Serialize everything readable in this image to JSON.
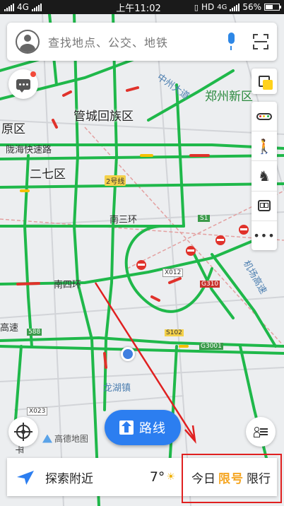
{
  "status_bar": {
    "network": "4G",
    "time": "上午11:02",
    "hd": "HD",
    "network_right": "4G",
    "battery": "56%",
    "battery_level": 0.56
  },
  "search": {
    "placeholder": "查找地点、公交、地铁"
  },
  "map": {
    "labels": {
      "zhongzhou_ave": "中州大道",
      "zhengzhou_new_district": "郑州新区",
      "guancheng": "管城回族区",
      "yuanqu": "原区",
      "longhai_expressway": "陇海快速路",
      "erqi": "二七区",
      "line2": "2号线",
      "nansanhuan": "南三环",
      "s1": "S1",
      "nansihuan": "南四环",
      "x012": "X012",
      "g310": "G310",
      "airport_expressway": "机场高速",
      "kuaisu": "高速",
      "g588": "588",
      "s102": "S102",
      "g3001": "G3001",
      "longhu": "龙湖镇",
      "x023": "X023",
      "heping": "和平"
    }
  },
  "route_button": {
    "label": "路线"
  },
  "brand": {
    "logo_text": "高德地图"
  },
  "bottom_bar": {
    "nearby_label": "探索附近",
    "temperature": "7°",
    "limit_prefix": "今日",
    "limit_number": "限号",
    "limit_suffix": "限行"
  },
  "colors": {
    "traffic_green": "#1fb84a",
    "traffic_red": "#e0322b",
    "traffic_yellow": "#f6c000",
    "accent_blue": "#2c7ef0",
    "annotation_red": "#e02020"
  }
}
